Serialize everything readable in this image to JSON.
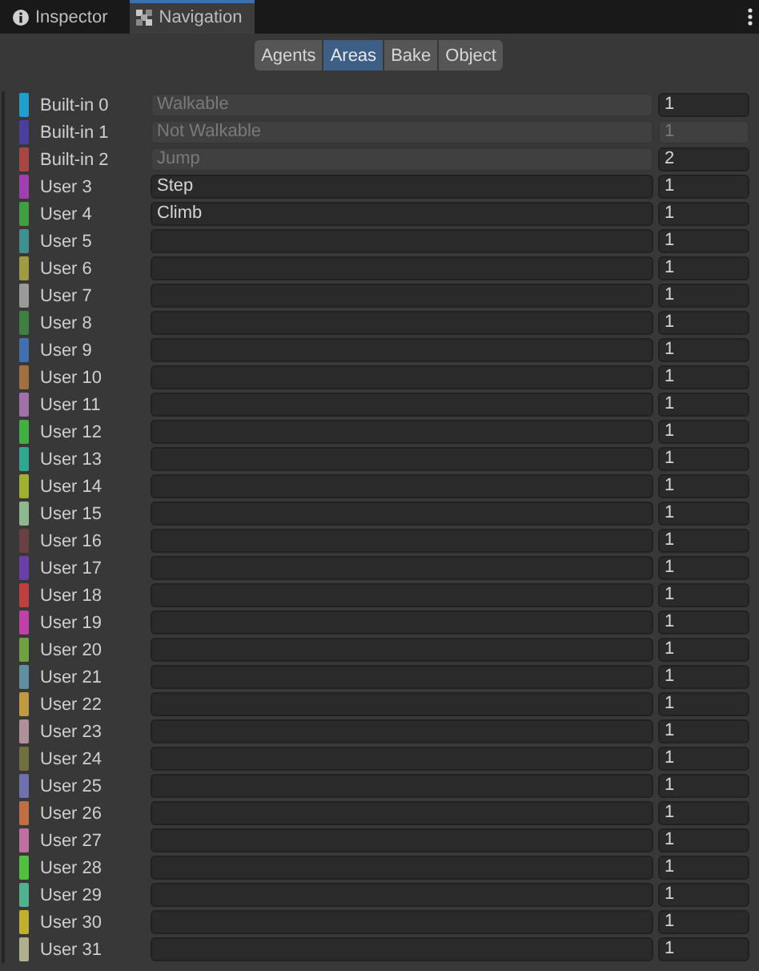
{
  "tabs": [
    {
      "label": "Inspector",
      "selected": false
    },
    {
      "label": "Navigation",
      "selected": true
    }
  ],
  "segments": [
    {
      "label": "Agents",
      "selected": false
    },
    {
      "label": "Areas",
      "selected": true
    },
    {
      "label": "Bake",
      "selected": false
    },
    {
      "label": "Object",
      "selected": false
    }
  ],
  "areas": [
    {
      "label": "Built-in 0",
      "color": "#1f9fd0",
      "name": "Walkable",
      "name_disabled": true,
      "cost": "1",
      "cost_disabled": false
    },
    {
      "label": "Built-in 1",
      "color": "#4a3fa0",
      "name": "Not Walkable",
      "name_disabled": true,
      "cost": "1",
      "cost_disabled": true
    },
    {
      "label": "Built-in 2",
      "color": "#a84545",
      "name": "Jump",
      "name_disabled": true,
      "cost": "2",
      "cost_disabled": false
    },
    {
      "label": "User 3",
      "color": "#a040b0",
      "name": "Step",
      "name_disabled": false,
      "cost": "1",
      "cost_disabled": false
    },
    {
      "label": "User 4",
      "color": "#40a040",
      "name": "Climb",
      "name_disabled": false,
      "cost": "1",
      "cost_disabled": false
    },
    {
      "label": "User 5",
      "color": "#3f9090",
      "name_disabled": false,
      "cost": "1",
      "cost_disabled": false
    },
    {
      "label": "User 6",
      "color": "#a09a40",
      "name_disabled": false,
      "cost": "1",
      "cost_disabled": false
    },
    {
      "label": "User 7",
      "color": "#9a9a9a",
      "name_disabled": false,
      "cost": "1",
      "cost_disabled": false
    },
    {
      "label": "User 8",
      "color": "#3f7f40",
      "name_disabled": false,
      "cost": "1",
      "cost_disabled": false
    },
    {
      "label": "User 9",
      "color": "#4070b0",
      "name_disabled": false,
      "cost": "1",
      "cost_disabled": false
    },
    {
      "label": "User 10",
      "color": "#a07040",
      "name_disabled": false,
      "cost": "1",
      "cost_disabled": false
    },
    {
      "label": "User 11",
      "color": "#a070a8",
      "name_disabled": false,
      "cost": "1",
      "cost_disabled": false
    },
    {
      "label": "User 12",
      "color": "#40b040",
      "name_disabled": false,
      "cost": "1",
      "cost_disabled": false
    },
    {
      "label": "User 13",
      "color": "#30a890",
      "name_disabled": false,
      "cost": "1",
      "cost_disabled": false
    },
    {
      "label": "User 14",
      "color": "#a0b030",
      "name_disabled": false,
      "cost": "1",
      "cost_disabled": false
    },
    {
      "label": "User 15",
      "color": "#90b890",
      "name_disabled": false,
      "cost": "1",
      "cost_disabled": false
    },
    {
      "label": "User 16",
      "color": "#6a4040",
      "name_disabled": false,
      "cost": "1",
      "cost_disabled": false
    },
    {
      "label": "User 17",
      "color": "#6a40a8",
      "name_disabled": false,
      "cost": "1",
      "cost_disabled": false
    },
    {
      "label": "User 18",
      "color": "#c04040",
      "name_disabled": false,
      "cost": "1",
      "cost_disabled": false
    },
    {
      "label": "User 19",
      "color": "#c040a8",
      "name_disabled": false,
      "cost": "1",
      "cost_disabled": false
    },
    {
      "label": "User 20",
      "color": "#70a040",
      "name_disabled": false,
      "cost": "1",
      "cost_disabled": false
    },
    {
      "label": "User 21",
      "color": "#6090a0",
      "name_disabled": false,
      "cost": "1",
      "cost_disabled": false
    },
    {
      "label": "User 22",
      "color": "#c09a40",
      "name_disabled": false,
      "cost": "1",
      "cost_disabled": false
    },
    {
      "label": "User 23",
      "color": "#b09098",
      "name_disabled": false,
      "cost": "1",
      "cost_disabled": false
    },
    {
      "label": "User 24",
      "color": "#70703f",
      "name_disabled": false,
      "cost": "1",
      "cost_disabled": false
    },
    {
      "label": "User 25",
      "color": "#6f70b0",
      "name_disabled": false,
      "cost": "1",
      "cost_disabled": false
    },
    {
      "label": "User 26",
      "color": "#c07040",
      "name_disabled": false,
      "cost": "1",
      "cost_disabled": false
    },
    {
      "label": "User 27",
      "color": "#c070a0",
      "name_disabled": false,
      "cost": "1",
      "cost_disabled": false
    },
    {
      "label": "User 28",
      "color": "#50c040",
      "name_disabled": false,
      "cost": "1",
      "cost_disabled": false
    },
    {
      "label": "User 29",
      "color": "#50b090",
      "name_disabled": false,
      "cost": "1",
      "cost_disabled": false
    },
    {
      "label": "User 30",
      "color": "#c0b030",
      "name_disabled": false,
      "cost": "1",
      "cost_disabled": false
    },
    {
      "label": "User 31",
      "color": "#b0b090",
      "name_disabled": false,
      "cost": "1",
      "cost_disabled": false
    }
  ]
}
